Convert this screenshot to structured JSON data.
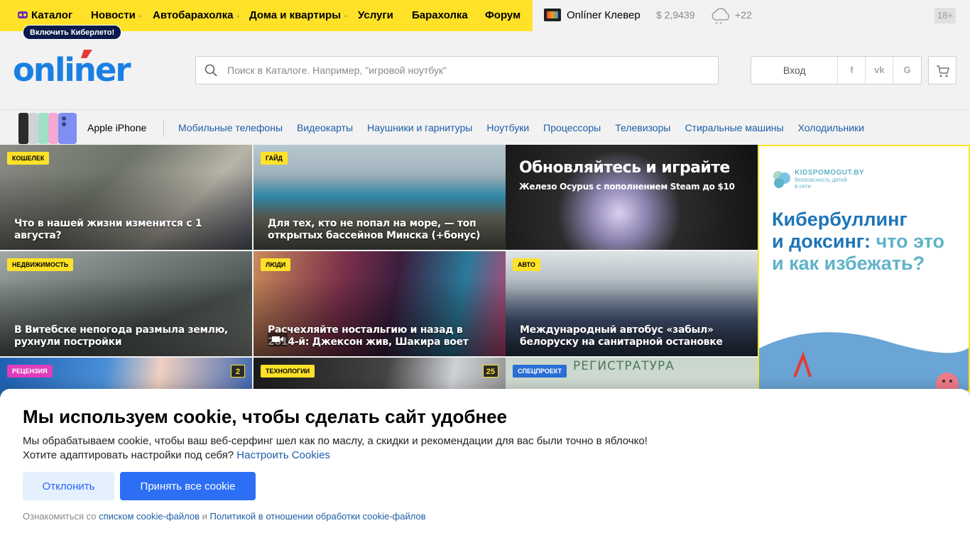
{
  "topbar": {
    "nav": [
      {
        "label": "Каталог",
        "dropdown": false
      },
      {
        "label": "Новости",
        "dropdown": true
      },
      {
        "label": "Автобарахолка",
        "dropdown": true
      },
      {
        "label": "Дома и квартиры",
        "dropdown": true
      },
      {
        "label": "Услуги",
        "dropdown": false
      },
      {
        "label": "Барахолка",
        "dropdown": false
      },
      {
        "label": "Форум",
        "dropdown": false
      }
    ],
    "cyber_badge": "Включить Киберлето!",
    "clever": "Onlíner Клевер",
    "rate": "$ 2,9439",
    "temperature": "+22",
    "age": "18+"
  },
  "header": {
    "search_placeholder": "Поиск в Каталоге. Например, \"игровой ноутбук\"",
    "login": "Вход",
    "social": [
      "f",
      "vk",
      "G"
    ],
    "brand_color": "#1a7fe3"
  },
  "catalog": {
    "featured": "Apple iPhone",
    "links": [
      "Мобильные телефоны",
      "Видеокарты",
      "Наушники и гарнитуры",
      "Ноутбуки",
      "Процессоры",
      "Телевизоры",
      "Стиральные машины",
      "Холодильники"
    ]
  },
  "news": [
    {
      "tag": "Кошелек",
      "title": "Что в нашей жизни изменится с 1 августа?"
    },
    {
      "tag": "Гайд",
      "title": "Для тех, кто не попал на море, — топ открытых бассейнов Минска (+бонус)"
    },
    {
      "tag": "",
      "title": "Обновляйтесь и играйте",
      "subtitle": "Железо Ocypus с пополнением Steam до $10"
    },
    {
      "tag": "Недвижимость",
      "title": "В Витебске непогода размыла землю, рухнули постройки"
    },
    {
      "tag": "Люди",
      "title": "Расчехляйте ностальгию и назад в 2014-й: Джексон жив, Шакира воет"
    },
    {
      "tag": "Авто",
      "title": "Международный автобус «забыл» белоруску на санитарной остановке"
    },
    {
      "tag": "Рецензия",
      "title": "",
      "comments": "2"
    },
    {
      "tag": "Технологии",
      "title": "",
      "comments": "25"
    },
    {
      "tag": "Спецпроект",
      "title": "",
      "sign": "РЕГИСТРАТУРА"
    }
  ],
  "ad": {
    "brand": "KIDSPOMOGUT.BY",
    "brand_sub_1": "безопасность детей",
    "brand_sub_2": "в сети",
    "headline_dark_1": "Кибербуллинг",
    "headline_dark_2": "и доксинг:",
    "headline_light_1": " что это",
    "headline_light_2": "и как избежать?"
  },
  "cookie": {
    "title": "Мы используем cookie, чтобы сделать сайт удобнее",
    "text_1": "Мы обрабатываем cookie, чтобы ваш веб-серфинг шел как по маслу, а скидки и рекомендации для вас были точно в яблочко!",
    "text_2": "Хотите адаптировать настройки под себя? ",
    "settings_link": "Настроить Cookies",
    "decline": "Отклонить",
    "accept": "Принять все cookie",
    "foot_prefix": "Ознакомиться со ",
    "foot_link_1": "списком cookie-файлов",
    "foot_mid": " и ",
    "foot_link_2": "Политикой в отношении обработки cookie-файлов"
  }
}
